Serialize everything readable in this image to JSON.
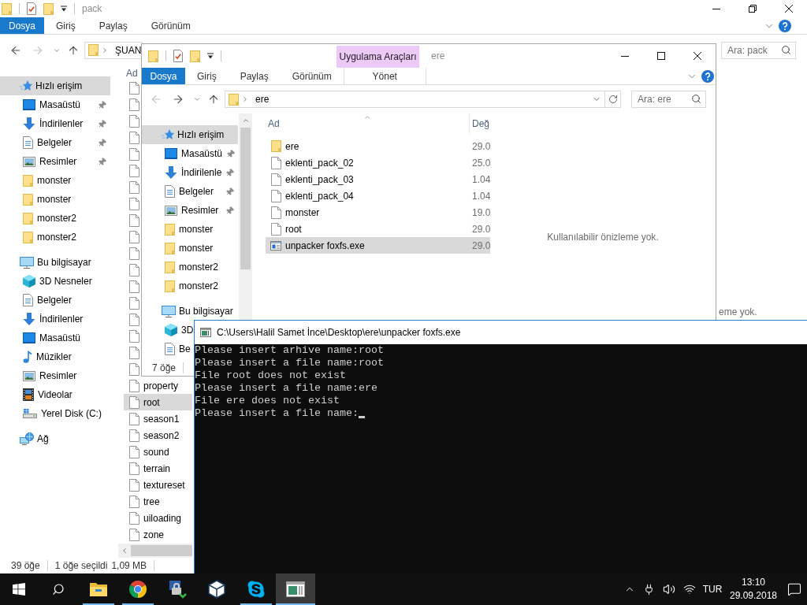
{
  "back_window": {
    "title": "pack",
    "maximized": true,
    "ribbon": {
      "file_tab": "Dosya",
      "tabs": [
        {
          "label": "Giriş",
          "kind": "standard"
        },
        {
          "label": "Paylaş",
          "kind": "standard"
        },
        {
          "label": "Görünüm",
          "kind": "standard"
        }
      ]
    },
    "history": {
      "back": true,
      "forward": false
    },
    "address": {
      "path": "ŞUAN"
    },
    "search": {
      "placeholder": "Ara: pack"
    },
    "navigation": [
      {
        "label": "Hızlı erişim",
        "kind": "star",
        "selected": true,
        "children": [
          {
            "label": "Masaüstü",
            "kind": "desktop",
            "selected": false,
            "pinned": true
          },
          {
            "label": "İndirilenler",
            "kind": "downloads",
            "selected": false,
            "pinned": true
          },
          {
            "label": "Belgeler",
            "kind": "documents",
            "selected": false,
            "pinned": true
          },
          {
            "label": "Resimler",
            "kind": "pictures",
            "selected": false,
            "pinned": true
          },
          {
            "label": "monster",
            "kind": "folder",
            "selected": false,
            "pinned": false
          },
          {
            "label": "monster",
            "kind": "folder",
            "selected": false,
            "pinned": false
          },
          {
            "label": "monster2",
            "kind": "folder",
            "selected": false,
            "pinned": false
          },
          {
            "label": "monster2",
            "kind": "folder",
            "selected": false,
            "pinned": false
          }
        ]
      },
      {
        "label": "Bu bilgisayar",
        "kind": "computer",
        "selected": false,
        "children": [
          {
            "label": "3D Nesneler",
            "kind": "objects",
            "selected": false
          },
          {
            "label": "Belgeler",
            "kind": "documents",
            "selected": false
          },
          {
            "label": "İndirilenler",
            "kind": "downloads",
            "selected": false
          },
          {
            "label": "Masaüstü",
            "kind": "desktop",
            "selected": false
          },
          {
            "label": "Müzikler",
            "kind": "music",
            "selected": false
          },
          {
            "label": "Resimler",
            "kind": "pictures",
            "selected": false
          },
          {
            "label": "Videolar",
            "kind": "videos",
            "selected": false
          },
          {
            "label": "Yerel Disk (C:)",
            "kind": "drive",
            "selected": false
          }
        ]
      },
      {
        "label": "Ağ",
        "kind": "network",
        "selected": false
      }
    ],
    "column_header": "Ad",
    "files": [
      {
        "name": "property",
        "selected": false
      },
      {
        "name": "root",
        "selected": true
      },
      {
        "name": "season1",
        "selected": false
      },
      {
        "name": "season2",
        "selected": false
      },
      {
        "name": "sound",
        "selected": false
      },
      {
        "name": "terrain",
        "selected": false
      },
      {
        "name": "textureset",
        "selected": false
      },
      {
        "name": "tree",
        "selected": false
      },
      {
        "name": "uiloading",
        "selected": false
      },
      {
        "name": "zone",
        "selected": false
      }
    ],
    "preview_text": "eme yok.",
    "status_bar": {
      "item_count": "39 öğe",
      "selection": "1 öğe seçildi",
      "size": "1,09 MB"
    }
  },
  "front_window": {
    "title": "ere",
    "maximized": false,
    "tool_group": "Uygulama Araçları",
    "ribbon": {
      "file_tab": "Dosya",
      "tabs": [
        {
          "label": "Giriş",
          "kind": "standard"
        },
        {
          "label": "Paylaş",
          "kind": "standard"
        },
        {
          "label": "Görünüm",
          "kind": "standard"
        },
        {
          "label": "Yönet",
          "kind": "contextual"
        }
      ]
    },
    "history": {
      "back": false,
      "forward": true
    },
    "address": {
      "path": "ere"
    },
    "search": {
      "placeholder": "Ara: ere"
    },
    "navigation": [
      {
        "label": "Hızlı erişim",
        "kind": "star",
        "selected": true,
        "children": [
          {
            "label": "Masaüstü",
            "kind": "desktop",
            "selected": false,
            "pinned": true
          },
          {
            "label": "İndirilenle",
            "kind": "downloads",
            "selected": false,
            "pinned": true
          },
          {
            "label": "Belgeler",
            "kind": "documents",
            "selected": false,
            "pinned": true
          },
          {
            "label": "Resimler",
            "kind": "pictures",
            "selected": false,
            "pinned": true
          },
          {
            "label": "monster",
            "kind": "folder",
            "selected": false,
            "pinned": false
          },
          {
            "label": "monster",
            "kind": "folder",
            "selected": false,
            "pinned": false
          },
          {
            "label": "monster2",
            "kind": "folder",
            "selected": false,
            "pinned": false
          },
          {
            "label": "monster2",
            "kind": "folder",
            "selected": false,
            "pinned": false
          }
        ]
      },
      {
        "label": "Bu bilgisayar",
        "kind": "computer",
        "selected": false,
        "children": [
          {
            "label": "3D",
            "kind": "objects",
            "selected": false
          },
          {
            "label": "Be",
            "kind": "documents",
            "selected": false
          }
        ]
      }
    ],
    "columns": [
      {
        "label": "Ad",
        "sorted": true
      },
      {
        "label": "Değ",
        "sorted": false
      }
    ],
    "files": [
      {
        "name": "ere",
        "kind": "folder",
        "date": "29.0",
        "selected": false
      },
      {
        "name": "eklenti_pack_02",
        "kind": "file",
        "date": "25.0",
        "selected": false
      },
      {
        "name": "eklenti_pack_03",
        "kind": "file",
        "date": "1.04",
        "selected": false
      },
      {
        "name": "eklenti_pack_04",
        "kind": "file",
        "date": "1.04",
        "selected": false
      },
      {
        "name": "monster",
        "kind": "file",
        "date": "19.0",
        "selected": false
      },
      {
        "name": "root",
        "kind": "file",
        "date": "29.0",
        "selected": false
      },
      {
        "name": "unpacker foxfs.exe",
        "kind": "exe",
        "date": "29.0",
        "selected": true
      }
    ],
    "preview_text": "Kullanılabilir önizleme yok.",
    "status_bar": {
      "item_count": "7 öğe"
    }
  },
  "console": {
    "title": "C:\\Users\\Halil Samet İnce\\Desktop\\ere\\unpacker foxfs.exe",
    "lines": [
      "Please insert arhive name:root",
      "Please insert a file name:root",
      "File root does not exist",
      "Please insert a file name:ere",
      "File ere does not exist",
      "Please insert a file name:"
    ],
    "cursor_visible": true
  },
  "taskbar": {
    "apps": [
      {
        "kind": "explorer",
        "running": true,
        "active": false
      },
      {
        "kind": "browser",
        "running": true,
        "active": false
      },
      {
        "kind": "lock",
        "running": false,
        "active": false
      },
      {
        "kind": "cube",
        "running": false,
        "active": false
      },
      {
        "kind": "chat",
        "running": true,
        "active": false
      },
      {
        "kind": "console",
        "running": true,
        "active": true
      }
    ],
    "language": "TUR",
    "time": "13:10",
    "date": "29.09.2018"
  }
}
